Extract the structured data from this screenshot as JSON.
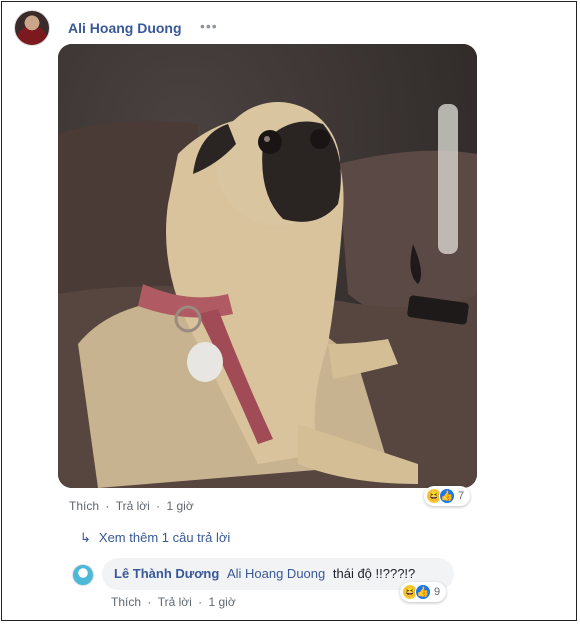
{
  "post": {
    "author": "Ali Hoang Duong",
    "more_label": "•••"
  },
  "comment_actions": {
    "like": "Thích",
    "reply": "Trả lời",
    "time": "1 giờ",
    "separator": "·"
  },
  "comment_reactions": {
    "icons": [
      "haha-icon",
      "like-icon"
    ],
    "count": "7"
  },
  "view_more_replies": {
    "label": "Xem thêm 1 câu trả lời"
  },
  "reply": {
    "author": "Lê Thành Dương",
    "tag": "Ali Hoang Duong",
    "text": "thái độ !!???!?",
    "actions": {
      "like": "Thích",
      "reply": "Trả lời",
      "time": "1 giờ",
      "separator": "·"
    },
    "reactions": {
      "icons": [
        "haha-icon",
        "like-icon"
      ],
      "count": "9"
    }
  },
  "colors": {
    "link": "#385898",
    "meta": "#606770",
    "bubble_bg": "#f2f3f5",
    "like_blue": "#1877f2",
    "haha_yellow": "#f7c93c"
  }
}
